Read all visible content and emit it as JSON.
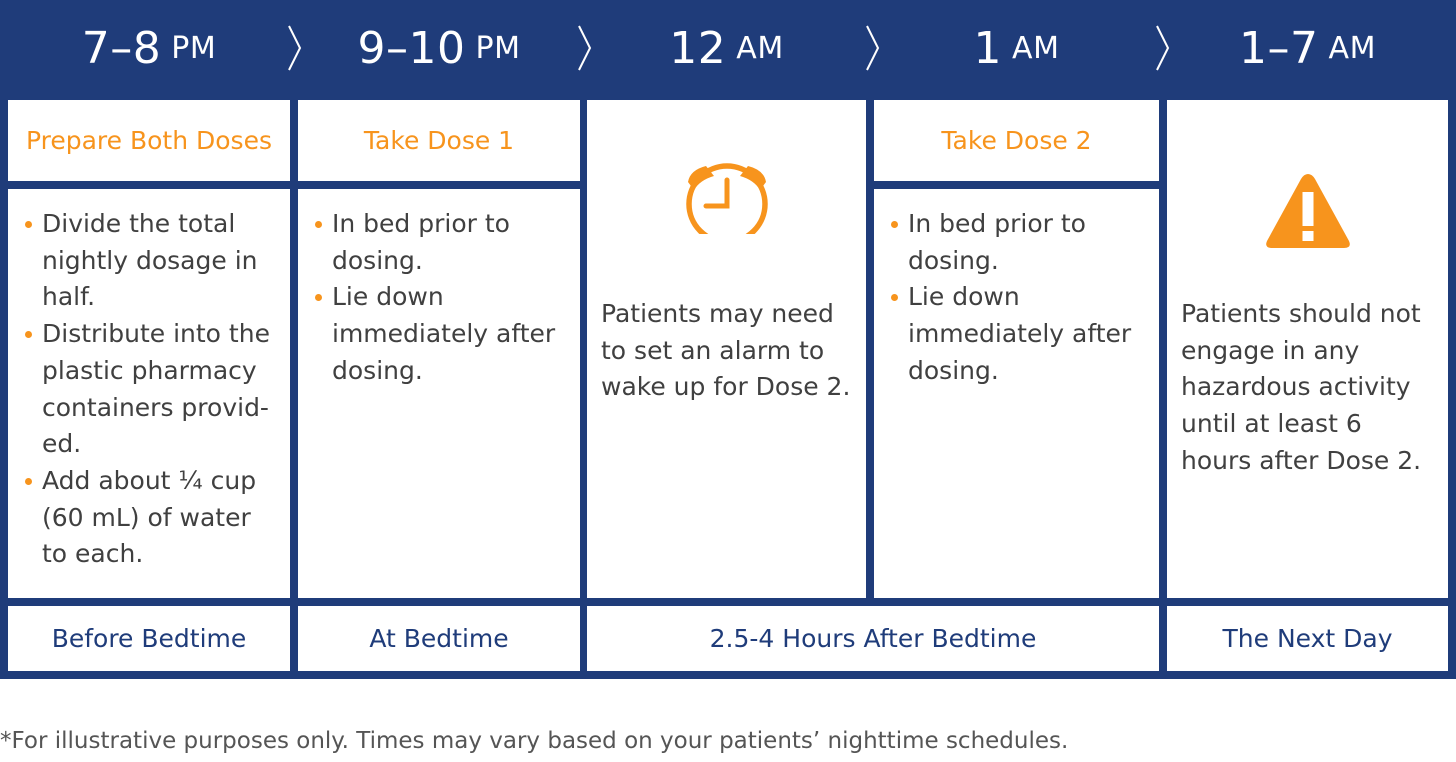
{
  "colors": {
    "navy": "#1f3c7a",
    "orange": "#f7941d",
    "text": "#404040"
  },
  "header": {
    "times": [
      {
        "num": "7–8",
        "period": "PM"
      },
      {
        "num": "9–10",
        "period": "PM"
      },
      {
        "num": "12",
        "period": "AM"
      },
      {
        "num": "1",
        "period": "AM"
      },
      {
        "num": "1–7",
        "period": "AM"
      }
    ],
    "separator_icon": "chevron-right-icon"
  },
  "columns": [
    {
      "title": "Prepare Both Doses",
      "bullets": [
        "Divide the total nightly dosage in half.",
        "Distribute into the plastic pharmacy containers provid-ed.",
        "Add about ¼ cup (60 mL) of water to each."
      ]
    },
    {
      "title": "Take Dose 1",
      "bullets": [
        "In bed prior to dosing.",
        "Lie down immediately after dosing."
      ]
    },
    {
      "icon": "alarm-clock-icon",
      "text": "Patients may need to set an alarm to wake up for Dose 2."
    },
    {
      "title": "Take Dose 2",
      "bullets": [
        "In bed prior to dosing.",
        "Lie down immediately after dosing."
      ]
    },
    {
      "icon": "warning-icon",
      "text": "Patients should not engage in any hazardous activity until at least 6 hours after Dose 2."
    }
  ],
  "footer_row": [
    "Before Bedtime",
    "At Bedtime",
    "2.5-4 Hours After Bedtime",
    "The Next Day"
  ],
  "footnote": "*For illustrative purposes only. Times may vary based on your patients’ nighttime schedules."
}
